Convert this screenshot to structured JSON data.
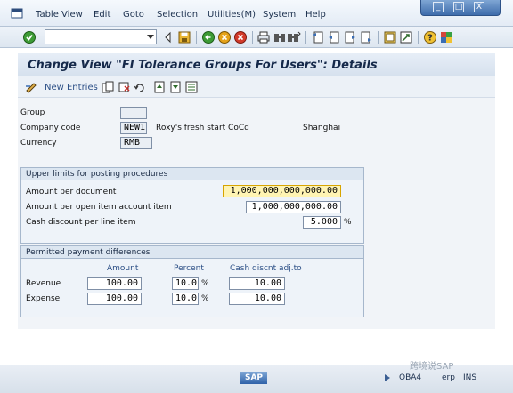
{
  "menubar": {
    "items": [
      "Table View",
      "Edit",
      "Goto",
      "Selection",
      "Utilities(M)",
      "System",
      "Help"
    ]
  },
  "window_controls": {
    "minimize": "_",
    "maximize": "□",
    "close": "X"
  },
  "toolbar": {
    "command_field_value": "",
    "icons": [
      "enter-check-icon",
      "save-icon",
      "back-icon",
      "exit-icon",
      "cancel-icon",
      "print-icon",
      "find-icon",
      "find-next-icon",
      "first-page-icon",
      "prev-page-icon",
      "next-page-icon",
      "last-page-icon",
      "create-session-icon",
      "shortcut-icon",
      "help-icon",
      "customize-layout-icon"
    ]
  },
  "title": "Change View \"FI Tolerance Groups For Users\": Details",
  "app_toolbar": {
    "new_entries": "New Entries"
  },
  "header_fields": {
    "group_label": "Group",
    "group_value": "",
    "company_code_label": "Company code",
    "company_code_value": "NEW1",
    "company_name": "Roxy's fresh start CoCd",
    "city": "Shanghai",
    "currency_label": "Currency",
    "currency_value": "RMB"
  },
  "upper_limits": {
    "title": "Upper limits for posting procedures",
    "amount_per_document_label": "Amount per document",
    "amount_per_document_value": "1,000,000,000,000.00",
    "amount_per_open_item_label": "Amount per open item account item",
    "amount_per_open_item_value": "1,000,000,000.00",
    "cash_discount_label": "Cash discount per line item",
    "cash_discount_value": "5.000",
    "cash_discount_unit": "%"
  },
  "payment_differences": {
    "title": "Permitted payment differences",
    "col_amount": "Amount",
    "col_percent": "Percent",
    "col_cash": "Cash discnt adj.to",
    "rows": [
      {
        "label": "Revenue",
        "amount": "100.00",
        "percent": "10.0",
        "unit": "%",
        "cash": "10.00"
      },
      {
        "label": "Expense",
        "amount": "100.00",
        "percent": "10.0",
        "unit": "%",
        "cash": "10.00"
      }
    ]
  },
  "statusbar": {
    "logo": "SAP",
    "transaction": "OBA4",
    "server": "erp",
    "mode": "INS",
    "watermark": "跨境说SAP"
  }
}
